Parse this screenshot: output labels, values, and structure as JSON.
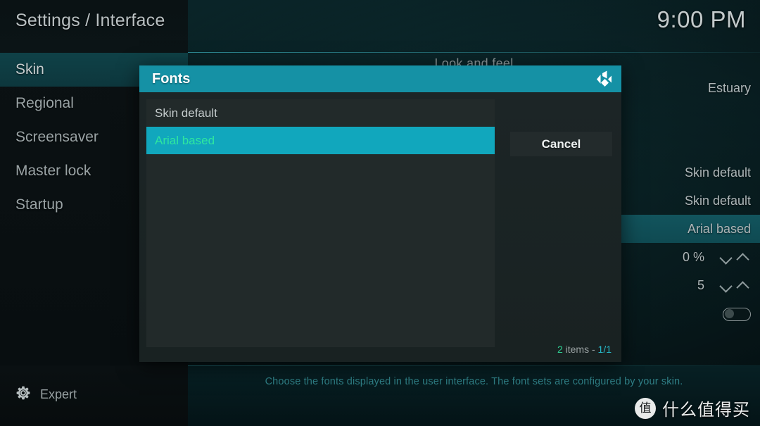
{
  "header": {
    "breadcrumb": "Settings / Interface",
    "clock": "9:00 PM"
  },
  "sidebar": {
    "items": [
      {
        "label": "Skin",
        "active": true
      },
      {
        "label": "Regional",
        "active": false
      },
      {
        "label": "Screensaver",
        "active": false
      },
      {
        "label": "Master lock",
        "active": false
      },
      {
        "label": "Startup",
        "active": false
      }
    ]
  },
  "content": {
    "category_title": "Look and feel",
    "settings": [
      {
        "value": "Estuary",
        "type": "text",
        "highlighted": false
      },
      {
        "value": "Skin default",
        "type": "text",
        "highlighted": false
      },
      {
        "value": "Skin default",
        "type": "text",
        "highlighted": false
      },
      {
        "value": "Arial based",
        "type": "text",
        "highlighted": true
      },
      {
        "value": "0 %",
        "type": "spinner",
        "highlighted": false
      },
      {
        "value": "5",
        "type": "spinner",
        "highlighted": false
      },
      {
        "value": "",
        "type": "toggle",
        "toggle_on": false,
        "highlighted": false
      }
    ]
  },
  "dialog": {
    "title": "Fonts",
    "logo_icon": "kodi-logo-icon",
    "items": [
      {
        "label": "Skin default",
        "selected": false
      },
      {
        "label": "Arial based",
        "selected": true
      }
    ],
    "cancel_label": "Cancel",
    "count_number": "2",
    "count_label": " items - ",
    "count_page": "1/1"
  },
  "bottom": {
    "level_icon": "gear-icon",
    "level_label": "Expert",
    "description": "Choose the fonts displayed in the user interface. The font sets are configured by your skin."
  },
  "watermark": {
    "badge": "值",
    "text": "什么值得买"
  },
  "colors": {
    "accent_teal": "#1591a5",
    "selected_bg": "#11a7bd",
    "selected_text": "#2ee6a0",
    "band": "#12545d",
    "desc_text": "#2f7f86"
  }
}
